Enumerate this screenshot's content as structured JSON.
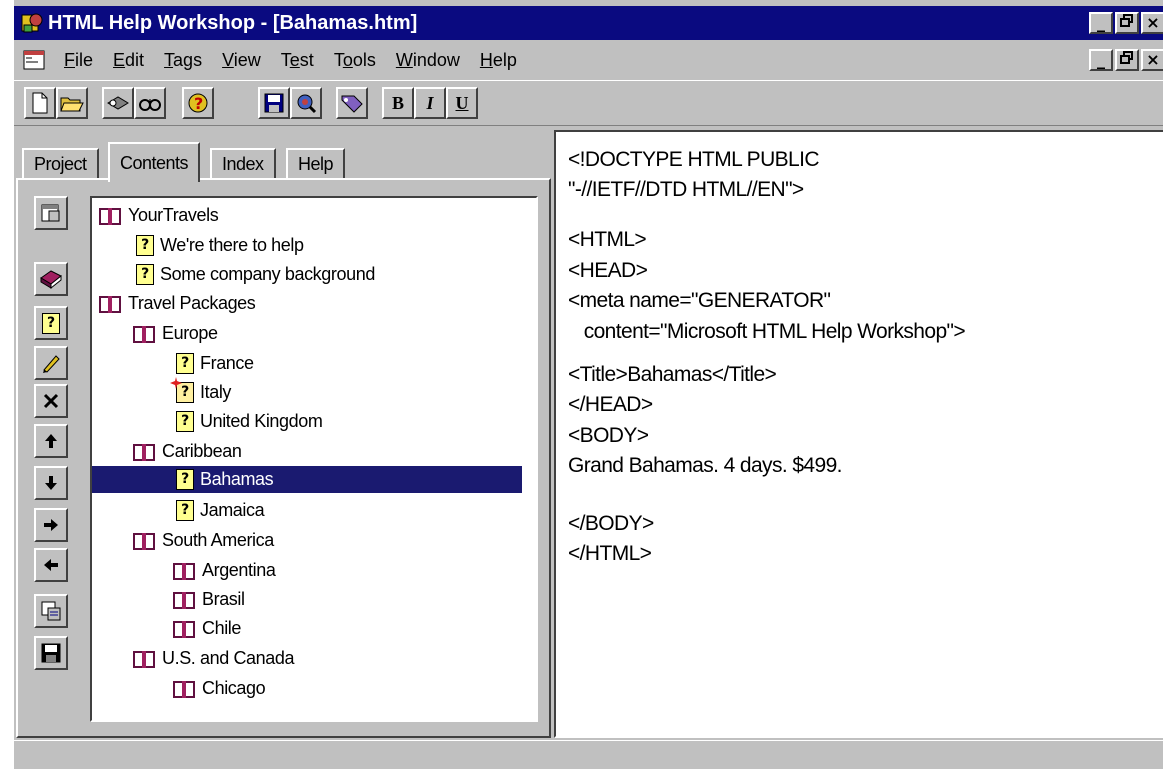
{
  "window": {
    "title": "HTML Help Workshop - [Bahamas.htm]",
    "minimize": "_",
    "maximize": " ",
    "close": "×"
  },
  "menu": {
    "items": [
      {
        "accel": "F",
        "rest": "ile"
      },
      {
        "accel": "E",
        "rest": "dit"
      },
      {
        "accel": "T",
        "rest": "ags"
      },
      {
        "accel": "V",
        "rest": "iew"
      },
      {
        "pre": "T",
        "accel": "e",
        "rest": "st"
      },
      {
        "pre": "T",
        "accel": "o",
        "rest": "ols"
      },
      {
        "accel": "W",
        "rest": "indow"
      },
      {
        "accel": "H",
        "rest": "elp"
      }
    ]
  },
  "toolbar": {
    "bold": "B",
    "italic": "I",
    "underline": "U",
    "icons": [
      "new-icon",
      "open-icon",
      "compile-icon",
      "view-compiled-icon",
      "wizard-icon",
      "save-icon",
      "preview-icon",
      "tag-icon"
    ]
  },
  "tabs": [
    "Project",
    "Contents",
    "Index",
    "Help"
  ],
  "active_tab": "Contents",
  "side_buttons": [
    "properties-icon",
    "insert-heading-icon",
    "insert-page-icon",
    "edit-icon",
    "delete-icon",
    "move-up-icon",
    "move-down-icon",
    "move-right-icon",
    "move-left-icon",
    "view-html-icon",
    "save-file-icon"
  ],
  "tree": {
    "nodes": [
      {
        "label": "YourTravels",
        "type": "book"
      },
      {
        "label": "We're there to help",
        "type": "page"
      },
      {
        "label": "Some company background",
        "type": "page"
      },
      {
        "label": "Travel Packages",
        "type": "book"
      },
      {
        "label": "Europe",
        "type": "book"
      },
      {
        "label": "France",
        "type": "page"
      },
      {
        "label": "Italy",
        "type": "page-new"
      },
      {
        "label": "United Kingdom",
        "type": "page"
      },
      {
        "label": "Caribbean",
        "type": "book"
      },
      {
        "label": "Bahamas",
        "type": "page",
        "selected": true
      },
      {
        "label": "Jamaica",
        "type": "page"
      },
      {
        "label": "South America",
        "type": "book"
      },
      {
        "label": "Argentina",
        "type": "book"
      },
      {
        "label": "Brasil",
        "type": "book"
      },
      {
        "label": "Chile",
        "type": "book"
      },
      {
        "label": "U.S. and Canada",
        "type": "book"
      },
      {
        "label": "Chicago",
        "type": "book"
      }
    ]
  },
  "editor": {
    "lines": [
      "<!DOCTYPE HTML PUBLIC",
      "\"-//IETF//DTD HTML//EN\">",
      "<HTML>",
      "<HEAD>",
      "<meta name=\"GENERATOR\"",
      "   content=\"Microsoft HTML Help Workshop\">",
      "<Title>Bahamas</Title>",
      "</HEAD>",
      "<BODY>",
      "Grand Bahamas. 4 days. $499.",
      "</BODY>",
      "</HTML>"
    ]
  },
  "colors": {
    "titlebar": "#0a0a80",
    "selection": "#1a1a70",
    "chrome": "#c0c0c0"
  }
}
